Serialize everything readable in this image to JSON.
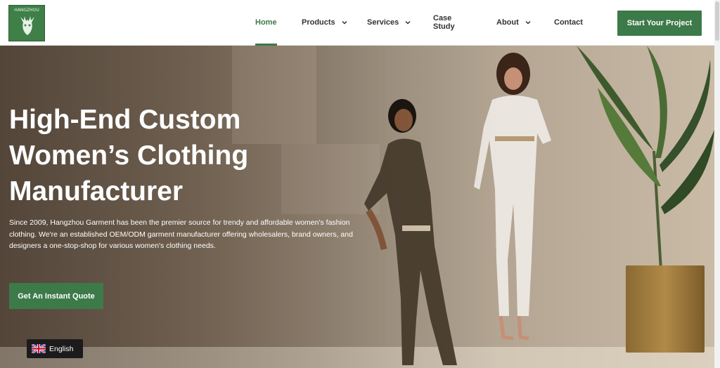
{
  "header": {
    "logo_text": "HANGZHOU",
    "nav": [
      {
        "label": "Home",
        "active": true,
        "has_dropdown": false
      },
      {
        "label": "Products",
        "active": false,
        "has_dropdown": true
      },
      {
        "label": "Services",
        "active": false,
        "has_dropdown": true
      },
      {
        "label": "Case Study",
        "active": false,
        "has_dropdown": false
      },
      {
        "label": "About",
        "active": false,
        "has_dropdown": true
      },
      {
        "label": "Contact",
        "active": false,
        "has_dropdown": false
      }
    ],
    "cta_label": "Start Your Project"
  },
  "hero": {
    "title": "High-End Custom Women’s Clothing Manufacturer",
    "description": "Since 2009, Hangzhou Garment has been the premier source for trendy and affordable women's fashion clothing. We're an established OEM/ODM garment manufacturer offering wholesalers, brand owners, and designers a one-stop-shop for various women's clothing needs.",
    "button_label": "Get An Instant Quote"
  },
  "language_switcher": {
    "label": "English",
    "flag_icon": "uk-flag-icon"
  },
  "colors": {
    "brand_green": "#3d7a49",
    "header_bg": "#ffffff",
    "language_bg": "#1b1b1b"
  }
}
